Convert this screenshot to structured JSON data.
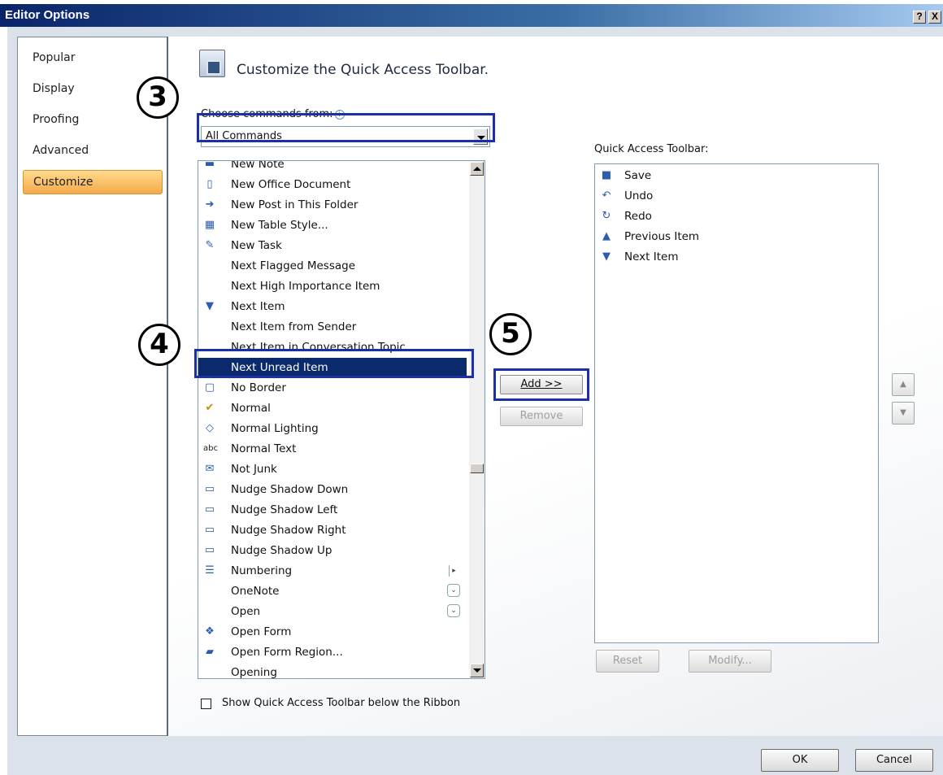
{
  "window": {
    "title": "Editor Options",
    "help_button": "?",
    "close_button": "X"
  },
  "sidebar": {
    "items": [
      {
        "label": "Popular"
      },
      {
        "label": "Display"
      },
      {
        "label": "Proofing"
      },
      {
        "label": "Advanced"
      },
      {
        "label": "Customize",
        "selected": true
      }
    ]
  },
  "main": {
    "heading": "Customize the Quick Access Toolbar.",
    "choose_label": "Choose commands from:",
    "choose_value": "All Commands",
    "commands": [
      {
        "label": "New Note",
        "icon": "note-icon"
      },
      {
        "label": "New Office Document",
        "icon": "document-icon"
      },
      {
        "label": "New Post in This Folder",
        "icon": "post-icon"
      },
      {
        "label": "New Table Style...",
        "icon": "table-style-icon"
      },
      {
        "label": "New Task",
        "icon": "task-icon"
      },
      {
        "label": "Next Flagged Message",
        "icon": ""
      },
      {
        "label": "Next High Importance Item",
        "icon": ""
      },
      {
        "label": "Next Item",
        "icon": "down-arrow-icon"
      },
      {
        "label": "Next Item from Sender",
        "icon": ""
      },
      {
        "label": "Next Item in Conversation Topic",
        "icon": ""
      },
      {
        "label": "Next Unread Item",
        "icon": "",
        "selected": true
      },
      {
        "label": "No Border",
        "icon": "no-border-icon"
      },
      {
        "label": "Normal",
        "icon": "checkmark-icon"
      },
      {
        "label": "Normal Lighting",
        "icon": "lighting-icon"
      },
      {
        "label": "Normal Text",
        "icon": "abc-icon"
      },
      {
        "label": "Not Junk",
        "icon": "not-junk-icon"
      },
      {
        "label": "Nudge Shadow Down",
        "icon": "nudge-down-icon"
      },
      {
        "label": "Nudge Shadow Left",
        "icon": "nudge-left-icon"
      },
      {
        "label": "Nudge Shadow Right",
        "icon": "nudge-right-icon"
      },
      {
        "label": "Nudge Shadow Up",
        "icon": "nudge-up-icon"
      },
      {
        "label": "Numbering",
        "icon": "numbering-icon",
        "submenu": "right"
      },
      {
        "label": "OneNote",
        "icon": "",
        "submenu": "down"
      },
      {
        "label": "Open",
        "icon": "",
        "submenu": "down"
      },
      {
        "label": "Open Form",
        "icon": "open-form-icon"
      },
      {
        "label": "Open Form Region...",
        "icon": "folder-icon"
      },
      {
        "label": "Opening",
        "icon": ""
      }
    ],
    "add_button": "Add >>",
    "remove_button": "Remove",
    "qat_label": "Quick Access Toolbar:",
    "qat_items": [
      {
        "label": "Save",
        "icon": "save-icon"
      },
      {
        "label": "Undo",
        "icon": "undo-icon"
      },
      {
        "label": "Redo",
        "icon": "redo-icon"
      },
      {
        "label": "Previous Item",
        "icon": "up-arrow-icon"
      },
      {
        "label": "Next Item",
        "icon": "down-arrow-icon"
      }
    ],
    "reset_button": "Reset",
    "modify_button": "Modify...",
    "show_below_label": "Show Quick Access Toolbar below the Ribbon",
    "show_below_checked": false
  },
  "footer": {
    "ok": "OK",
    "cancel": "Cancel"
  },
  "callouts": [
    "3",
    "4",
    "5"
  ],
  "colors": {
    "selection": "#0a2a6b",
    "callout_border": "#1b2fa8",
    "selected_tab": "#f5a94a"
  }
}
